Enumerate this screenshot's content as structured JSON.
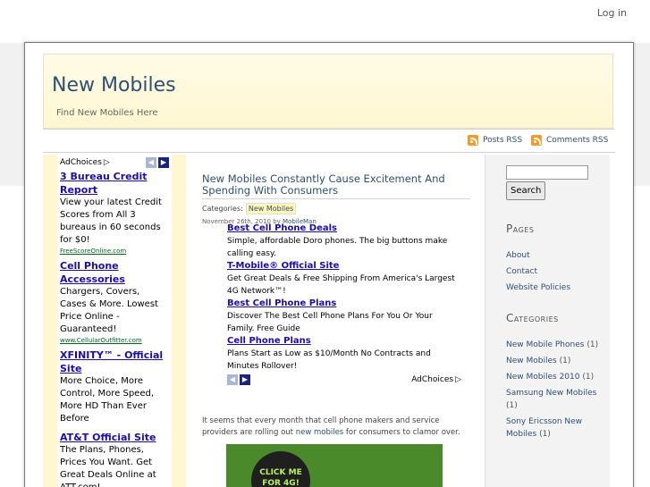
{
  "top": {
    "login_label": "Log in"
  },
  "header": {
    "title": "New Mobiles",
    "description": "Find New Mobiles Here"
  },
  "feeds": {
    "posts_rss": "Posts RSS",
    "comments_rss": "Comments RSS"
  },
  "left_ad": {
    "adchoices": "AdChoices",
    "ads": [
      {
        "title": "3 Bureau Credit Report",
        "text": "View your latest Credit Scores from All 3 bureaus in 60 seconds for $0!",
        "url": "FreeScoreOnline.com"
      },
      {
        "title": "Cell Phone Accessories",
        "text": "Chargers, Covers, Cases & More. Lowest Price Online - Guaranteed!",
        "url": "www.CellularOutfitter.com"
      },
      {
        "title": "XFINITY™ - Official Site",
        "text": "More Choice, More Control, More Speed, More HD Than Ever Before",
        "url": ""
      },
      {
        "title": "AT&T Official Site",
        "text": "The Plans, Phones, Prices You Want. Get Great Deals Online at ATT.com!",
        "url": ""
      }
    ]
  },
  "post": {
    "title": "New Mobiles Constantly Cause Excitement And Spending With Consumers",
    "categories_label": "Categories:",
    "category": "New Mobiles",
    "date": "November 26th, 2010 by",
    "author": "MobileMan",
    "body_before": "It seems that every month that cell phone makers and service providers are rolling out ",
    "body_link": "new mobiles",
    "body_after": " for consumers to clamor over."
  },
  "inline_ad": {
    "adchoices": "AdChoices",
    "ads": [
      {
        "title": "Best Cell Phone Deals",
        "text": "Simple, affordable Doro phones. The big buttons make calling easy."
      },
      {
        "title": "T-Mobile® Official Site",
        "text": "Get Great Deals & Free Shipping From America's Largest 4G Network™!"
      },
      {
        "title": "Best Cell Phone Plans",
        "text": "Discover The Best Cell Phone Plans For You Or Your Family. Free Guide"
      },
      {
        "title": "Cell Phone Plans",
        "text": "Plans Start as Low as $10/Month No Contracts and Minutes Rollover!"
      }
    ]
  },
  "banner": {
    "text": "CLICK ME FOR 4G!"
  },
  "sidebar": {
    "search_button": "Search",
    "pages_heading": "Pages",
    "pages": [
      "About",
      "Contact",
      "Website Policies"
    ],
    "categories_heading": "Categories",
    "categories": [
      {
        "name": "New Mobile Phones",
        "count": "(1)"
      },
      {
        "name": "New Mobiles",
        "count": "(1)"
      },
      {
        "name": "New Mobiles 2010",
        "count": "(1)"
      },
      {
        "name": "Samsung New Mobiles",
        "count": "(1)"
      },
      {
        "name": "Sony Ericsson New Mobiles",
        "count": "(1)"
      }
    ]
  }
}
